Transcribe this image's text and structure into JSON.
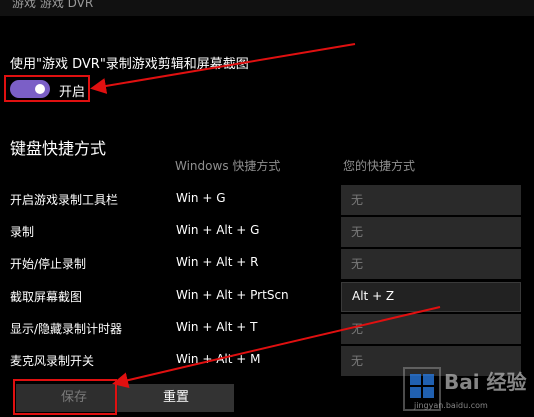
{
  "top_title": "游戏 游戏 DVR",
  "dvr": {
    "label": "使用\"游戏 DVR\"录制游戏剪辑和屏幕截图",
    "toggle_state": "开启"
  },
  "shortcuts": {
    "title": "键盘快捷方式",
    "col_default": "Windows 快捷方式",
    "col_custom": "您的快捷方式",
    "rows": [
      {
        "name": "开启游戏录制工具栏",
        "default": "Win + G",
        "custom": "无"
      },
      {
        "name": "录制",
        "default": "Win + Alt + G",
        "custom": "无"
      },
      {
        "name": "开始/停止录制",
        "default": "Win + Alt + R",
        "custom": "无"
      },
      {
        "name": "截取屏幕截图",
        "default": "Win + Alt + PrtScn",
        "custom": "Alt + Z"
      },
      {
        "name": "显示/隐藏录制计时器",
        "default": "Win + Alt + T",
        "custom": "无"
      },
      {
        "name": "麦克风录制开关",
        "default": "Win + Alt + M",
        "custom": "无"
      }
    ]
  },
  "buttons": {
    "save": "保存",
    "reset": "重置"
  },
  "watermark": {
    "text": "Bai 经验",
    "url": "jingyan.baidu.com"
  },
  "colors": {
    "accent": "#7b5fc7",
    "annotation": "#e01010"
  }
}
